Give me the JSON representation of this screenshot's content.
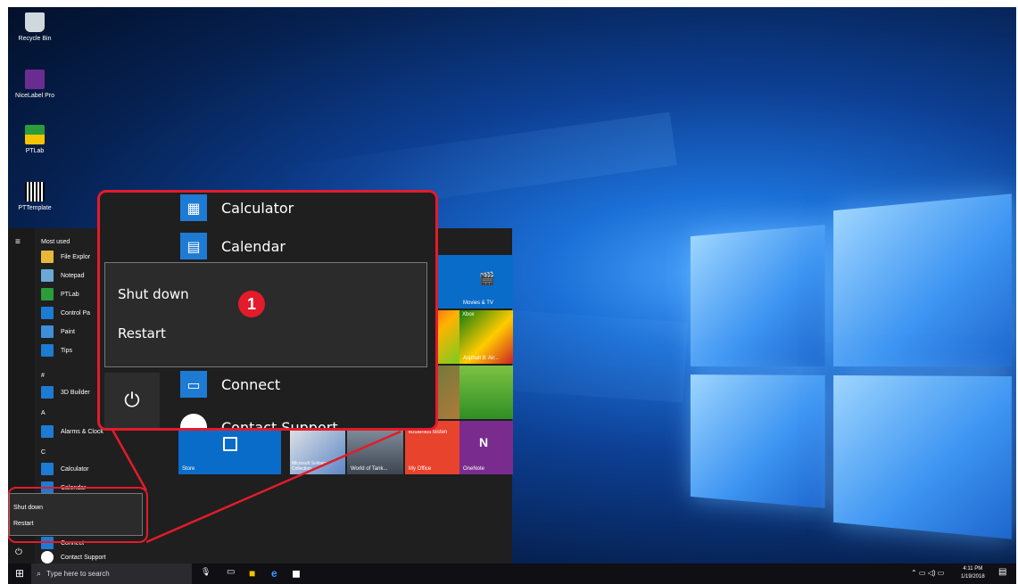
{
  "desktop": {
    "icons": [
      {
        "label": "Recycle Bin",
        "icon": "recycle-bin-icon",
        "color": "#cfd8dc"
      },
      {
        "label": "NiceLabel Pro",
        "icon": "nicelabel-icon",
        "color": "#6a2c91"
      },
      {
        "label": "PTLab",
        "icon": "ptlab-icon",
        "color": "#2a9d3a"
      },
      {
        "label": "PTTemplate",
        "icon": "pttemplate-icon",
        "color": "#ffffff"
      }
    ]
  },
  "start_menu": {
    "most_used_header": "Most used",
    "items": [
      {
        "label": "File Explor",
        "icon": "file-explorer-icon"
      },
      {
        "label": "Notepad",
        "icon": "notepad-icon"
      },
      {
        "label": "PTLab",
        "icon": "ptlab-icon"
      },
      {
        "label": "Control Pa",
        "icon": "control-panel-icon"
      },
      {
        "label": "Paint",
        "icon": "paint-icon"
      },
      {
        "label": "Tips",
        "icon": "tips-icon"
      }
    ],
    "letter_hash": "#",
    "item_3dbuilder": "3D Builder",
    "letter_a": "A",
    "item_alarms": "Alarms & Clock",
    "letter_c": "C",
    "item_calculator": "Calculator",
    "item_calendar": "Calendar",
    "item_connect": "Connect",
    "item_contact": "Contact Support",
    "power_menu": {
      "shutdown": "Shut down",
      "restart": "Restart"
    },
    "tiles": [
      {
        "label": "Movies & TV"
      },
      {
        "label": "Xbox"
      },
      {
        "label": "Asphalt 8: Air..."
      },
      {
        "label": "Store"
      },
      {
        "label": "Microsoft Solitaire Collection"
      },
      {
        "label": "World of Tank..."
      },
      {
        "label": "My Office"
      },
      {
        "label": "OneNote"
      },
      {
        "label": "Office 365 kostenlos testen"
      }
    ]
  },
  "zoom_callout": {
    "calculator": "Calculator",
    "calendar": "Calendar",
    "shutdown": "Shut down",
    "restart": "Restart",
    "connect": "Connect",
    "contact": "Contact Support",
    "step_number": "1"
  },
  "taskbar": {
    "search_placeholder": "Type here to search",
    "time": "4:11 PM",
    "date": "1/19/2018"
  },
  "colors": {
    "accent": "#0a6cc9",
    "callout": "#e31b2a"
  }
}
